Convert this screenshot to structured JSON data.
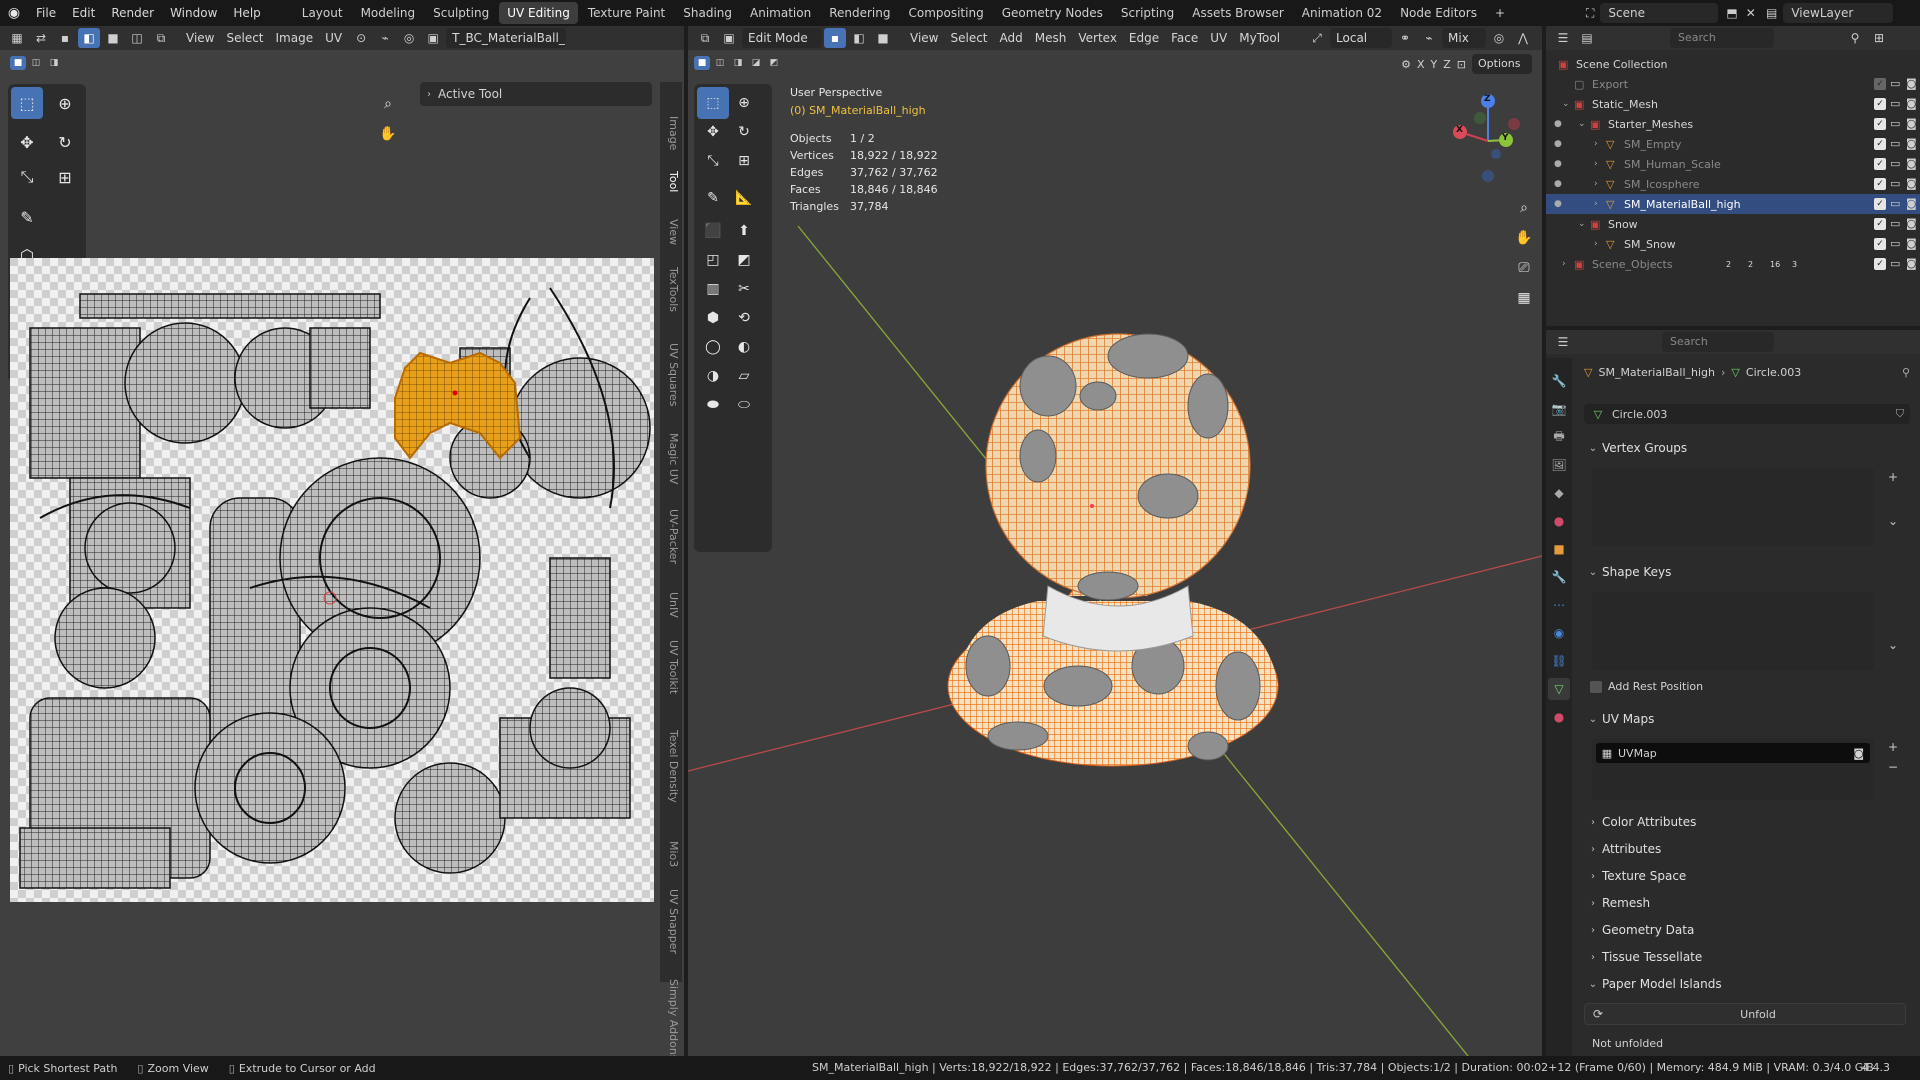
{
  "menu": {
    "items": [
      "File",
      "Edit",
      "Render",
      "Window",
      "Help"
    ]
  },
  "workspaces": [
    "Layout",
    "Modeling",
    "Sculpting",
    "UV Editing",
    "Texture Paint",
    "Shading",
    "Animation",
    "Rendering",
    "Compositing",
    "Geometry Nodes",
    "Scripting",
    "Assets Browser",
    "Animation 02",
    "Node Editors"
  ],
  "workspace_add": "+",
  "scene": "Scene",
  "view_layer": "ViewLayer",
  "uv_editor": {
    "menus": [
      "View",
      "Select",
      "Image",
      "UV"
    ],
    "image_name": "T_BC_MaterialBall_Pain",
    "active_tool_label": "Active Tool",
    "side_tabs": [
      "Image",
      "Tool",
      "View",
      "TexTools",
      "UV Squares",
      "Magic UV",
      "UV-Packer",
      "UnIV",
      "UV Toolkit",
      "Texel Density",
      "Mio3",
      "UV Snapper",
      "Simply Addons"
    ]
  },
  "viewport": {
    "mode": "Edit Mode",
    "menus": [
      "View",
      "Select",
      "Add",
      "Mesh",
      "Vertex",
      "Edge",
      "Face",
      "UV",
      "MyTool"
    ],
    "orientation": "Local",
    "snap_mode": "Mix",
    "options_label": "Options",
    "axes": [
      "X",
      "Y",
      "Z"
    ],
    "overlay_title": "User Perspective",
    "overlay_object": "(0) SM_MaterialBall_high",
    "stats": [
      [
        "Objects",
        "1 / 2"
      ],
      [
        "Vertices",
        "18,922 / 18,922"
      ],
      [
        "Edges",
        "37,762 / 37,762"
      ],
      [
        "Faces",
        "18,846 / 18,846"
      ],
      [
        "Triangles",
        "37,784"
      ]
    ],
    "gizmo": {
      "x": "X",
      "y": "Y",
      "z": "Z"
    }
  },
  "outliner": {
    "search_placeholder": "Search",
    "rows": [
      {
        "label": "Scene Collection"
      },
      {
        "label": "Export"
      },
      {
        "label": "Static_Mesh"
      },
      {
        "label": "Starter_Meshes"
      },
      {
        "label": "SM_Empty"
      },
      {
        "label": "SM_Human_Scale"
      },
      {
        "label": "SM_Icosphere"
      },
      {
        "label": "SM_MaterialBall_high"
      },
      {
        "label": "Snow"
      },
      {
        "label": "SM_Snow"
      },
      {
        "label": "Scene_Objects"
      }
    ],
    "scene_objects_counts": [
      "2",
      "2",
      "16",
      "3"
    ]
  },
  "properties": {
    "search_placeholder": "Search",
    "breadcrumb_object": "SM_MaterialBall_high",
    "breadcrumb_data": "Circle.003",
    "mesh_name": "Circle.003",
    "panels": {
      "vertex_groups": "Vertex Groups",
      "shape_keys": "Shape Keys",
      "add_rest_position": "Add Rest Position",
      "uv_maps": "UV Maps",
      "uv_map_item": "UVMap",
      "collapsed": [
        "Color Attributes",
        "Attributes",
        "Texture Space",
        "Remesh",
        "Geometry Data",
        "Tissue Tessellate"
      ],
      "paper_model": "Paper Model Islands",
      "unfold": "Unfold",
      "not_unfolded": "Not unfolded"
    }
  },
  "status": {
    "hints": [
      "Pick Shortest Path",
      "Zoom View",
      "Extrude to Cursor or Add"
    ],
    "info": "SM_MaterialBall_high | Verts:18,922/18,922 | Edges:37,762/37,762 | Faces:18,846/18,846 | Tris:37,784 | Objects:1/2 | Duration: 00:02+12 (Frame 0/60) | Memory: 484.9 MiB | VRAM: 0.3/4.0 GiB",
    "version": "4.4.3"
  },
  "colors": {
    "selection": "#4772b3",
    "accent_orange": "#e8a04a",
    "header": "#303030",
    "viewport_bg": "#3d3d3d"
  }
}
